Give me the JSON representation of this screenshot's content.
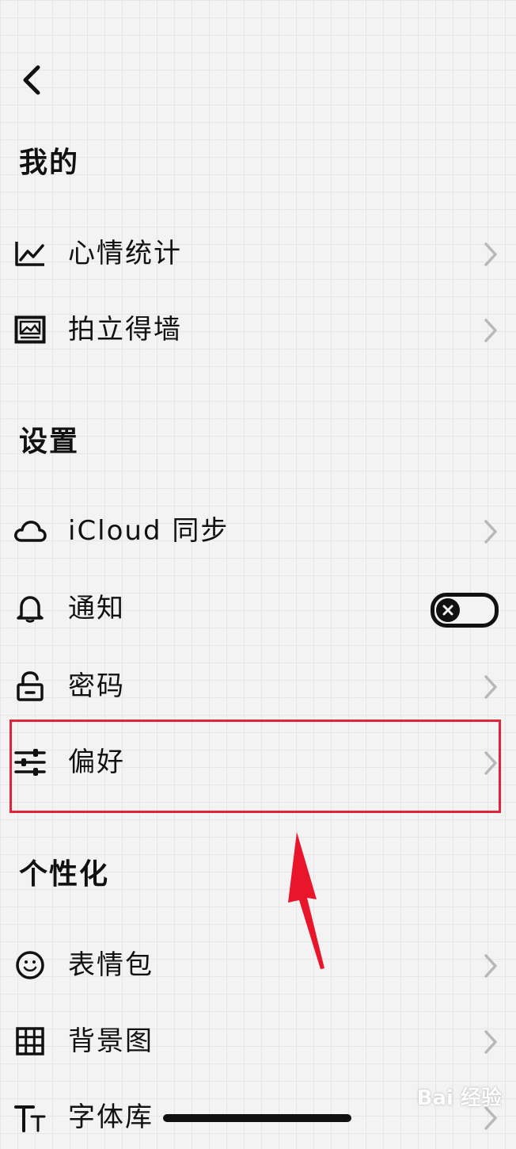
{
  "sections": {
    "mine": {
      "title": "我的"
    },
    "settings": {
      "title": "设置"
    },
    "personalize": {
      "title": "个性化"
    }
  },
  "rows": {
    "mood_stats": {
      "label": "心情统计",
      "icon": "line-chart-icon"
    },
    "polaroid_wall": {
      "label": "拍立得墙",
      "icon": "photo-icon"
    },
    "icloud_sync": {
      "label": "iCloud 同步",
      "icon": "cloud-icon"
    },
    "notification": {
      "label": "通知",
      "icon": "bell-icon",
      "toggle": "off"
    },
    "password": {
      "label": "密码",
      "icon": "lock-icon"
    },
    "preferences": {
      "label": "偏好",
      "icon": "sliders-icon"
    },
    "stickers": {
      "label": "表情包",
      "icon": "smiley-icon"
    },
    "background": {
      "label": "背景图",
      "icon": "grid-icon"
    },
    "fonts": {
      "label": "字体库",
      "icon": "text-size-icon"
    }
  },
  "watermark": "Bai 经验",
  "colors": {
    "background": "#f3f3f3",
    "grid": "#e6e6e6",
    "text": "#111111",
    "chevron": "#b8b8b8",
    "highlight": "#e0243a"
  }
}
